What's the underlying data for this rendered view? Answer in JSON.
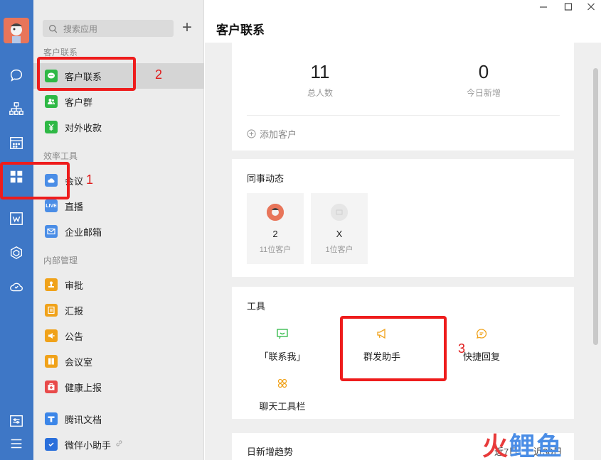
{
  "sidebar": {
    "search_placeholder": "搜索应用",
    "sections": {
      "customer": "客户联系",
      "efficiency": "效率工具",
      "internal": "内部管理"
    },
    "items": {
      "kehu_lianxi": "客户联系",
      "kehu_qun": "客户群",
      "duiwai_shoukuan": "对外收款",
      "huiyi": "会议",
      "zhibo": "直播",
      "qiye_youxiang": "企业邮箱",
      "shenpi": "审批",
      "huibao": "汇报",
      "gonggao": "公告",
      "huiyishi": "会议室",
      "jiankang": "健康上报",
      "tengxun_wendang": "腾讯文档",
      "weiban": "微伴小助手"
    },
    "live_badge": "LIVE"
  },
  "header": {
    "title": "客户联系"
  },
  "stats": {
    "total_value": "11",
    "total_label": "总人数",
    "today_value": "0",
    "today_label": "今日新增",
    "add_label": "添加客户"
  },
  "colleagues": {
    "title": "同事动态",
    "list": [
      {
        "name": "2",
        "count": "11位客户"
      },
      {
        "name": "X",
        "count": "1位客户"
      }
    ]
  },
  "tools": {
    "title": "工具",
    "items": {
      "contact_me": "「联系我」",
      "mass_send": "群发助手",
      "quick_reply": "快捷回复",
      "chat_toolbar": "聊天工具栏"
    }
  },
  "trend": {
    "title": "日新增趋势",
    "range_7": "近7日",
    "range_30": "近30日"
  },
  "annotations": {
    "n1": "1",
    "n2": "2",
    "n3": "3"
  },
  "watermark": "鲤鱼",
  "colors": {
    "rail": "#3e77c6",
    "annotation": "#ee1c1c",
    "green": "#2eb845",
    "orange": "#f0a21a"
  }
}
